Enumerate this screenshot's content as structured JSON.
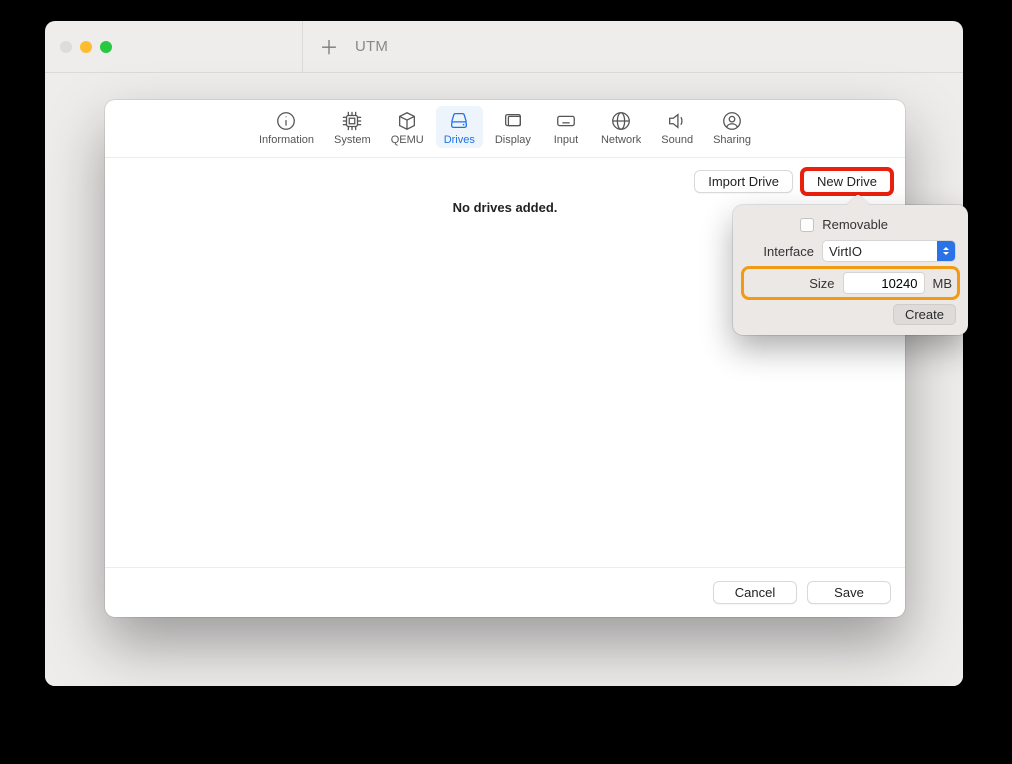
{
  "app": {
    "title": "UTM"
  },
  "tabs": [
    {
      "label": "Information"
    },
    {
      "label": "System"
    },
    {
      "label": "QEMU"
    },
    {
      "label": "Drives"
    },
    {
      "label": "Display"
    },
    {
      "label": "Input"
    },
    {
      "label": "Network"
    },
    {
      "label": "Sound"
    },
    {
      "label": "Sharing"
    }
  ],
  "drives": {
    "import_label": "Import Drive",
    "new_label": "New Drive",
    "empty_message": "No drives added."
  },
  "popover": {
    "removable_label": "Removable",
    "removable_checked": false,
    "interface_label": "Interface",
    "interface_value": "VirtIO",
    "size_label": "Size",
    "size_value": "10240",
    "size_unit": "MB",
    "create_label": "Create"
  },
  "footer": {
    "cancel": "Cancel",
    "save": "Save"
  }
}
